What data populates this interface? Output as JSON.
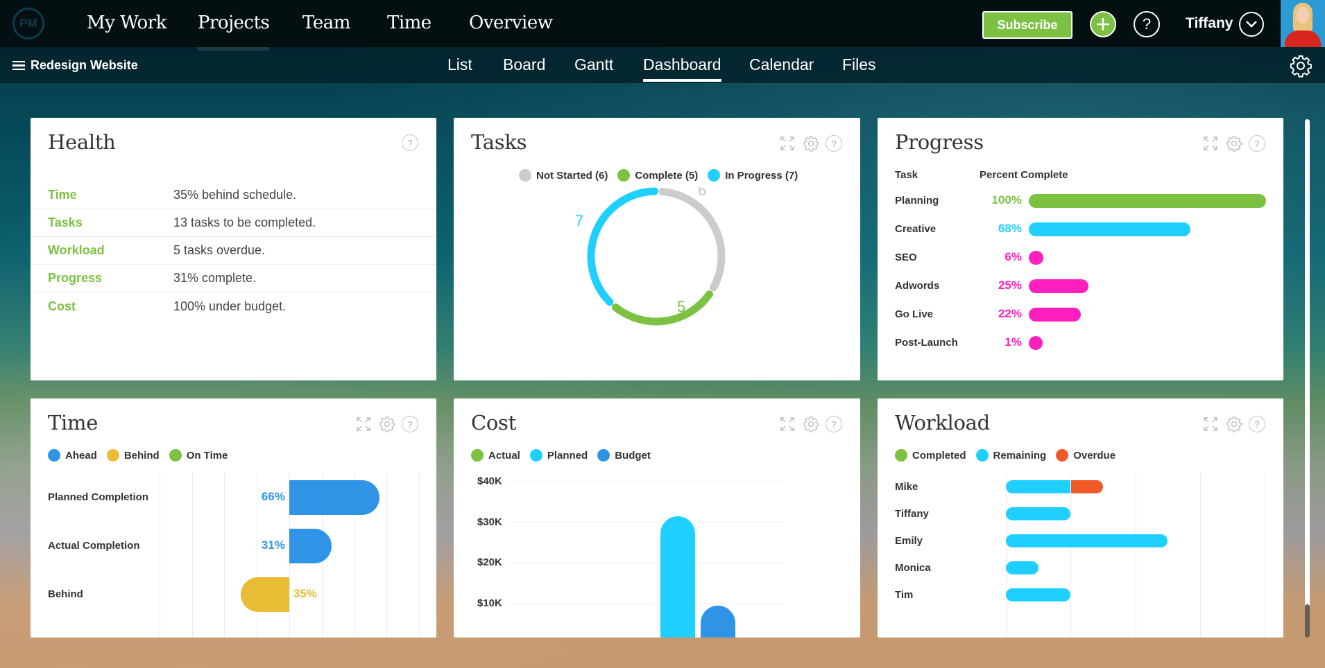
{
  "app": {
    "logo_text": "PM"
  },
  "main_nav": [
    {
      "label": "My Work",
      "active": false
    },
    {
      "label": "Projects",
      "active": true
    },
    {
      "label": "Team",
      "active": false
    },
    {
      "label": "Time",
      "active": false
    },
    {
      "label": "Overview",
      "active": false
    }
  ],
  "header": {
    "subscribe_label": "Subscribe",
    "add_icon": "plus-circle-icon",
    "help_icon": "question-circle-icon",
    "user_name": "Tiffany",
    "user_menu_icon": "chevron-down-circle-icon"
  },
  "project": {
    "name": "Redesign Website",
    "menu_icon": "hamburger-icon"
  },
  "view_tabs": [
    {
      "label": "List",
      "active": false
    },
    {
      "label": "Board",
      "active": false
    },
    {
      "label": "Gantt",
      "active": false
    },
    {
      "label": "Dashboard",
      "active": true
    },
    {
      "label": "Calendar",
      "active": false
    },
    {
      "label": "Files",
      "active": false
    }
  ],
  "colors": {
    "green": "#7cc142",
    "cyan": "#1fcfff",
    "blue": "#2f94e6",
    "gray": "#cccccc",
    "magenta": "#ff1fbe",
    "yellow": "#e8bd35",
    "orange": "#f05a28"
  },
  "health": {
    "title": "Health",
    "rows": [
      {
        "label": "Time",
        "value": "35% behind schedule."
      },
      {
        "label": "Tasks",
        "value": "13 tasks to be completed."
      },
      {
        "label": "Workload",
        "value": "5 tasks overdue."
      },
      {
        "label": "Progress",
        "value": "31% complete."
      },
      {
        "label": "Cost",
        "value": "100% under budget."
      }
    ]
  },
  "tasks": {
    "title": "Tasks",
    "legend": [
      {
        "label": "Not Started (6)",
        "color": "#cccccc"
      },
      {
        "label": "Complete (5)",
        "color": "#7cc142"
      },
      {
        "label": "In Progress (7)",
        "color": "#1fcfff"
      }
    ]
  },
  "progress": {
    "title": "Progress",
    "col_task": "Task",
    "col_percent": "Percent Complete"
  },
  "time": {
    "title": "Time",
    "legend": [
      {
        "label": "Ahead",
        "color": "#2f94e6"
      },
      {
        "label": "Behind",
        "color": "#e8bd35"
      },
      {
        "label": "On Time",
        "color": "#7cc142"
      }
    ]
  },
  "cost": {
    "title": "Cost",
    "legend": [
      {
        "label": "Actual",
        "color": "#7cc142"
      },
      {
        "label": "Planned",
        "color": "#1fcfff"
      },
      {
        "label": "Budget",
        "color": "#2f94e6"
      }
    ]
  },
  "workload": {
    "title": "Workload",
    "legend": [
      {
        "label": "Completed",
        "color": "#7cc142"
      },
      {
        "label": "Remaining",
        "color": "#1fcfff"
      },
      {
        "label": "Overdue",
        "color": "#f05a28"
      }
    ]
  },
  "chart_data": [
    {
      "id": "tasks",
      "type": "pie",
      "title": "Tasks",
      "categories": [
        "Not Started",
        "Complete",
        "In Progress"
      ],
      "values": [
        6,
        5,
        7
      ],
      "colors": [
        "#cccccc",
        "#7cc142",
        "#1fcfff"
      ],
      "donut": true,
      "legend": "top"
    },
    {
      "id": "progress",
      "type": "bar",
      "orientation": "horizontal",
      "title": "Progress",
      "xlabel": "Percent Complete",
      "categories": [
        "Planning",
        "Creative",
        "SEO",
        "Adwords",
        "Go Live",
        "Post-Launch"
      ],
      "values": [
        100,
        68,
        6,
        25,
        22,
        1
      ],
      "labels": [
        "100%",
        "68%",
        "6%",
        "25%",
        "22%",
        "1%"
      ],
      "colors": [
        "#7cc142",
        "#1fcfff",
        "#ff1fbe",
        "#ff1fbe",
        "#ff1fbe",
        "#ff1fbe"
      ],
      "xlim": [
        0,
        100
      ]
    },
    {
      "id": "time",
      "type": "bar",
      "orientation": "horizontal",
      "title": "Time",
      "categories": [
        "Planned Completion",
        "Actual Completion",
        "Behind"
      ],
      "values": [
        66,
        31,
        -35
      ],
      "labels": [
        "66%",
        "31%",
        "35%"
      ],
      "colors": [
        "#2f94e6",
        "#2f94e6",
        "#e8bd35"
      ],
      "xlim": [
        -100,
        100
      ],
      "grid": true,
      "legend": "top-left"
    },
    {
      "id": "cost",
      "type": "bar",
      "title": "Cost",
      "categories": [
        ""
      ],
      "series": [
        {
          "name": "Actual",
          "values": [
            0
          ],
          "color": "#7cc142"
        },
        {
          "name": "Planned",
          "values": [
            31500
          ],
          "color": "#1fcfff"
        },
        {
          "name": "Budget",
          "values": [
            9500
          ],
          "color": "#2f94e6"
        }
      ],
      "yticks": [
        "$10K",
        "$20K",
        "$30K",
        "$40K"
      ],
      "ytick_values": [
        10000,
        20000,
        30000,
        40000
      ],
      "ylim": [
        0,
        40000
      ],
      "grid": true,
      "legend": "top-left"
    },
    {
      "id": "workload",
      "type": "bar",
      "orientation": "horizontal",
      "stacked": true,
      "title": "Workload",
      "categories": [
        "Mike",
        "Tiffany",
        "Emily",
        "Monica",
        "Tim"
      ],
      "series": [
        {
          "name": "Completed",
          "values": [
            0,
            0,
            0,
            0,
            0
          ],
          "color": "#7cc142"
        },
        {
          "name": "Remaining",
          "values": [
            2,
            2,
            5,
            1,
            2
          ],
          "color": "#1fcfff"
        },
        {
          "name": "Overdue",
          "values": [
            1,
            0,
            0,
            0,
            0
          ],
          "color": "#f05a28"
        }
      ],
      "xlim": [
        0,
        8
      ],
      "grid": true,
      "legend": "top-left"
    }
  ]
}
